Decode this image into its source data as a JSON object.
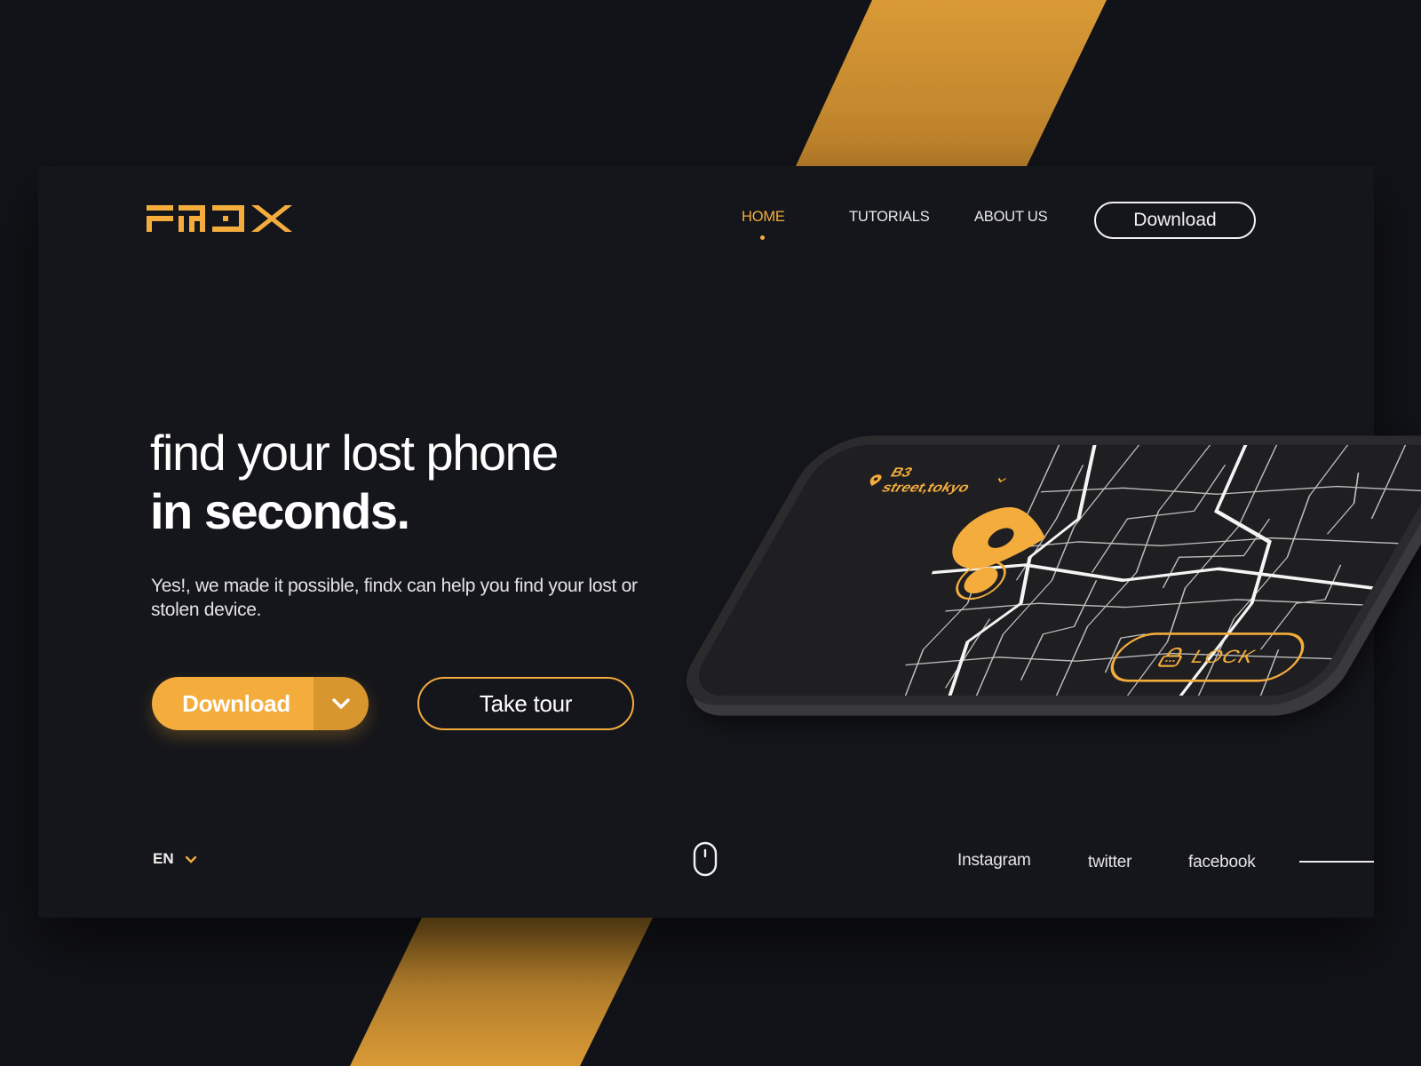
{
  "colors": {
    "accent": "#f4ad3d",
    "accent_dark": "#d8962f",
    "background": "#121318",
    "card": "#15161b",
    "text": "#ffffff"
  },
  "brand": {
    "logo_text": "FINDX"
  },
  "nav": {
    "items": [
      {
        "label": "HOME",
        "active": true
      },
      {
        "label": "TUTORIALS",
        "active": false
      },
      {
        "label": "ABOUT US",
        "active": false
      }
    ],
    "download_label": "Download"
  },
  "hero": {
    "title_line1": "find your lost phone",
    "title_line2": "in seconds.",
    "description": "Yes!, we made it possible, findx can help you find your lost or stolen device.",
    "primary_button": "Download",
    "secondary_button": "Take tour"
  },
  "phone_screen": {
    "location_label": "B3 street,tokyo",
    "lock_label": "LOCK",
    "icons": [
      "location-pin-icon",
      "lock-icon"
    ]
  },
  "footer": {
    "language": "EN",
    "social": [
      "Instagram",
      "twitter",
      "facebook"
    ],
    "scroll_icon": "mouse-scroll-icon"
  }
}
